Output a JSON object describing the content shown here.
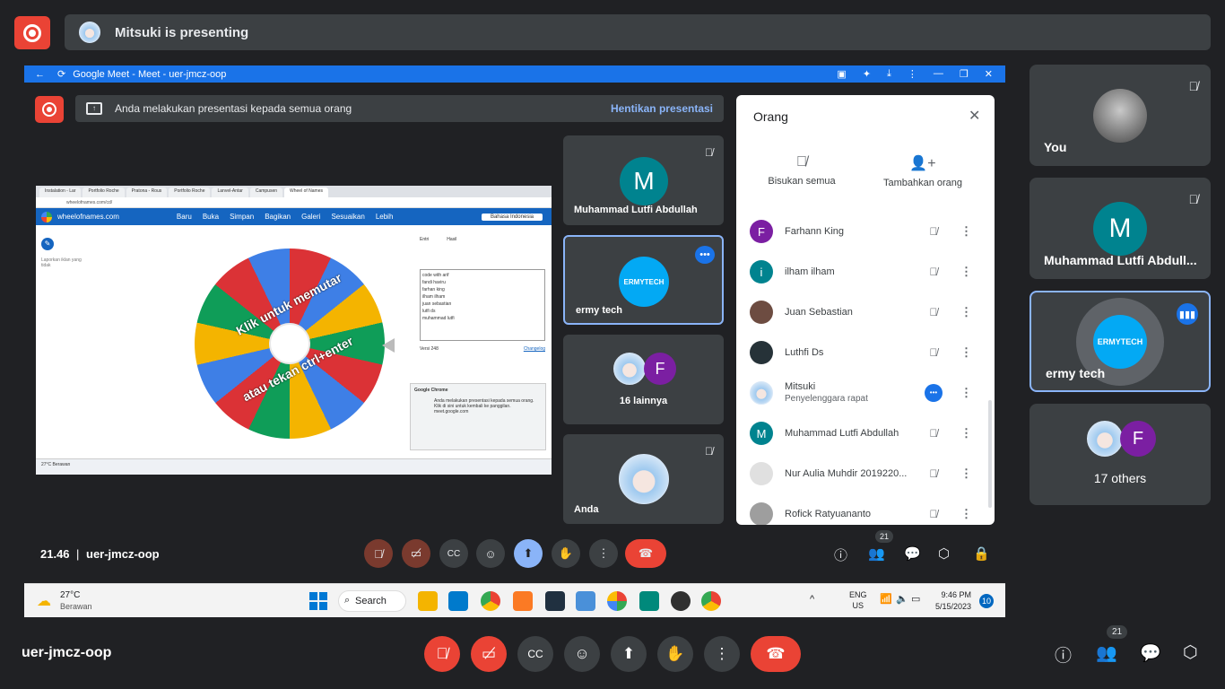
{
  "header": {
    "presenting_text": "Mitsuki is presenting"
  },
  "share": {
    "browser_title": "Google Meet - Meet - uer-jmcz-oop",
    "inner_banner": "Anda melakukan presentasi kepada semua orang",
    "stop_label": "Hentikan presentasi",
    "wheel": {
      "tabs": [
        "Instalation - Lar",
        "Portfolio Roche",
        "Pratona - Rous",
        "Portfolio Roche",
        "Lanvel-Antar",
        "Campusen",
        "Wheel of Names"
      ],
      "address": "wheelofnames.com/cd/",
      "site": "wheelofnames.com",
      "menu": [
        "Baru",
        "Buka",
        "Simpan",
        "Bagikan",
        "Galeri",
        "Sesuaikan",
        "Lebih"
      ],
      "language": "Bahasa Indonesia",
      "wheel_text_1": "Klik untuk memutar",
      "wheel_text_2": "atau tekan ctrl+enter",
      "tab_entries": "Entri",
      "tab_results": "Hasil",
      "entries": [
        "code with arif",
        "fandi haviru",
        "farhan king",
        "ilham ilham",
        "juan sebastian",
        "lutfi ds",
        "muhammad lutfi"
      ],
      "version": "Versi 248",
      "changelog": "Changelog",
      "popup_title": "Google Chrome",
      "popup_text": "Anda melakukan presentasi kepada semua orang. Klik di sini untuk kembali ke panggilan. meet.google.com",
      "side_text": "Laporkan iklan yang tidak",
      "weather": "27°C Berawan"
    },
    "tiles": [
      {
        "name": "Muhammad Lutfi Abdullah",
        "initial": "M"
      },
      {
        "name": "ermy tech",
        "logo": "ERMYTECH"
      },
      {
        "name": "16 lainnya",
        "initial": "F"
      },
      {
        "name": "Anda"
      }
    ],
    "people_panel": {
      "title": "Orang",
      "mute_all": "Bisukan semua",
      "add_people": "Tambahkan orang",
      "list": [
        {
          "name": "Farhann King",
          "initial": "F",
          "color": "#7b1fa2"
        },
        {
          "name": "ilham ilham",
          "initial": "i",
          "color": "#00838f"
        },
        {
          "name": "Juan Sebastian",
          "initial": "",
          "color": "#6d4c41"
        },
        {
          "name": "Luthfi Ds",
          "initial": "",
          "color": "#263238"
        },
        {
          "name": "Mitsuki",
          "sub": "Penyelenggara rapat",
          "initial": "",
          "color": "#cfe3f6"
        },
        {
          "name": "Muhammad Lutfi Abdullah",
          "initial": "M",
          "color": "#00838f"
        },
        {
          "name": "Nur Aulia Muhdir 2019220...",
          "initial": "",
          "color": "#e0e0e0"
        },
        {
          "name": "Rofick Ratyuananto",
          "initial": "",
          "color": "#9e9e9e"
        }
      ]
    },
    "meeting_time": "21.46",
    "meeting_code": "uer-jmcz-oop",
    "people_count": "21",
    "taskbar": {
      "temp": "27°C",
      "weather": "Berawan",
      "search": "Search",
      "lang": "ENG",
      "region": "US",
      "time": "9:46 PM",
      "date": "5/15/2023",
      "notif": "10"
    }
  },
  "side_tiles": [
    {
      "name": "You"
    },
    {
      "name": "Muhammad Lutfi Abdull...",
      "initial": "M"
    },
    {
      "name": "ermy tech",
      "logo": "ERMYTECH"
    },
    {
      "name": "17 others",
      "initial": "F"
    }
  ],
  "bottom": {
    "meeting_code": "uer-jmcz-oop",
    "people_count": "21"
  },
  "colors": {
    "accent": "#8ab4f8",
    "red": "#ea4335",
    "surface": "#3c4043",
    "bg": "#202124",
    "teal": "#00838f",
    "purple": "#7b1fa2"
  }
}
